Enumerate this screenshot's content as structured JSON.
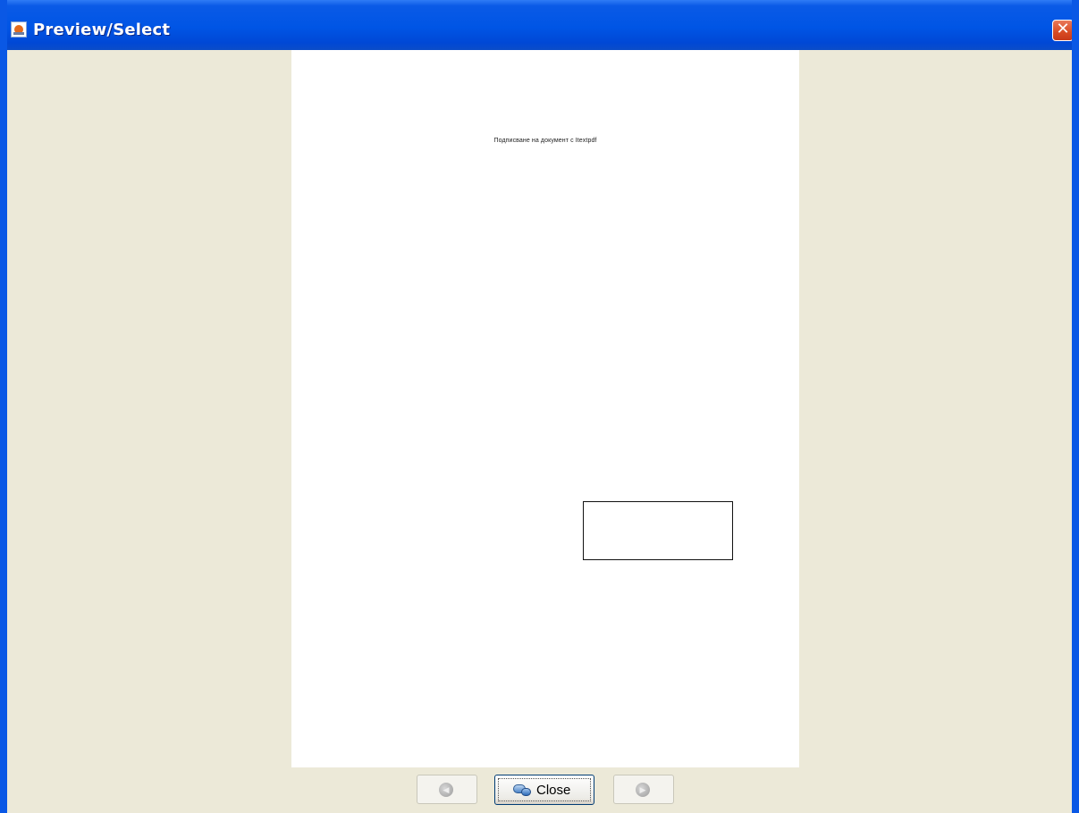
{
  "window": {
    "title": "Preview/Select",
    "close_glyph": "✕",
    "title_icon": "java-app-icon"
  },
  "document": {
    "text": "Подписване на документ с Itextpdf",
    "signature_field": "signature-rectangle"
  },
  "buttons": {
    "prev_icon": "◀",
    "close_label": "Close",
    "close_icon": "close-link-icon",
    "next_icon": "▶"
  },
  "colors": {
    "titlebar": "#0055e5",
    "background": "#ece9d8",
    "page": "#ffffff"
  }
}
